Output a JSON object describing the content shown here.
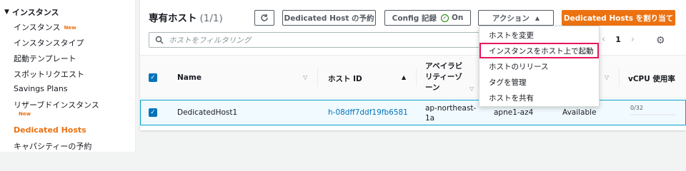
{
  "sidebar": {
    "section": "インスタンス",
    "items": [
      {
        "label": "インスタンス",
        "badge": "New"
      },
      {
        "label": "インスタンスタイプ"
      },
      {
        "label": "起動テンプレート"
      },
      {
        "label": "スポットリクエスト"
      },
      {
        "label": "Savings Plans"
      },
      {
        "label": "リザーブドインスタンス",
        "badge": "New"
      },
      {
        "label": "Dedicated Hosts",
        "active": true
      },
      {
        "label": "キャパシティーの予約"
      }
    ]
  },
  "header": {
    "title": "専有ホスト",
    "count": "(1/1)",
    "reserve_label": "Dedicated Host の予約",
    "config_label": "Config 記録",
    "config_state": "On",
    "action_label": "アクション",
    "allocate_label": "Dedicated Hosts を割り当て"
  },
  "filter": {
    "placeholder": "ホストをフィルタリング"
  },
  "pager": {
    "page": "1"
  },
  "table": {
    "columns": [
      "Name",
      "ホスト ID",
      "アベイラビリティーゾーン",
      "vCPU 使用率"
    ],
    "az_col_lines": [
      "アベイラビ",
      "リティーゾ",
      "ーン"
    ],
    "rows": [
      {
        "name": "DedicatedHost1",
        "host_id": "h-08dff7ddf19fb6581",
        "az_lines": [
          "ap-northeast-",
          "1a"
        ],
        "az_id": "apne1-az4",
        "state": "Available",
        "vcpu": "0/32"
      }
    ]
  },
  "action_menu": {
    "items": [
      "ホストを変更",
      "インスタンスをホスト上で起動",
      "ホストのリリース",
      "タグを管理",
      "ホストを共有"
    ],
    "highlighted_index": 1
  },
  "colors": {
    "accent": "#ec7211",
    "link": "#0073bb",
    "highlight": "#e8175d"
  }
}
